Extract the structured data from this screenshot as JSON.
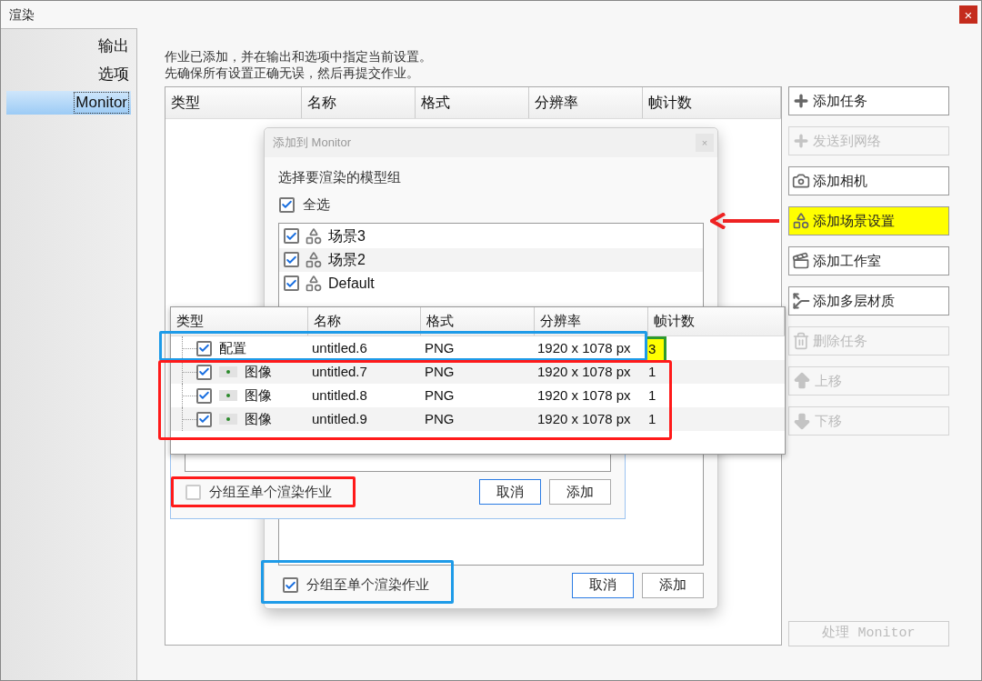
{
  "window": {
    "title": "渲染",
    "close": "×"
  },
  "sidebar": {
    "items": [
      {
        "label": "输出",
        "selected": false
      },
      {
        "label": "选项",
        "selected": false
      },
      {
        "label": "Monitor",
        "selected": true
      }
    ]
  },
  "description": [
    "作业已添加，并在输出和选项中指定当前设置。",
    "先确保所有设置正确无误，然后再提交作业。"
  ],
  "table": {
    "columns": [
      "类型",
      "名称",
      "格式",
      "分辨率",
      "帧计数"
    ]
  },
  "actions": [
    {
      "label": "添加任务",
      "kind": "add",
      "disabled": false,
      "highlighted": false
    },
    {
      "label": "发送到网络",
      "kind": "add",
      "disabled": true,
      "highlighted": false
    },
    {
      "label": "添加相机",
      "kind": "camera",
      "disabled": false,
      "highlighted": false
    },
    {
      "label": "添加场景设置",
      "kind": "scene",
      "disabled": false,
      "highlighted": true
    },
    {
      "label": "添加工作室",
      "kind": "studio",
      "disabled": false,
      "highlighted": false
    },
    {
      "label": "添加多层材质",
      "kind": "material",
      "disabled": false,
      "highlighted": false
    },
    {
      "label": "删除任务",
      "kind": "delete",
      "disabled": true,
      "highlighted": false
    },
    {
      "label": "上移",
      "kind": "up",
      "disabled": true,
      "highlighted": false
    },
    {
      "label": "下移",
      "kind": "down",
      "disabled": true,
      "highlighted": false
    }
  ],
  "process_button": {
    "label": "处理 Monitor",
    "disabled": true
  },
  "add_dialog": {
    "title": "添加到 Monitor",
    "close": "×",
    "prompt": "选择要渲染的模型组",
    "select_all": {
      "label": "全选",
      "checked": true
    },
    "groups": [
      {
        "label": "场景3",
        "checked": true
      },
      {
        "label": "场景2",
        "checked": true
      },
      {
        "label": "Default",
        "checked": true
      }
    ],
    "group_option": {
      "label": "分组至单个渲染作业",
      "checked": true
    },
    "buttons": [
      "取消",
      "添加"
    ]
  },
  "second_dialog": {
    "group_option": {
      "label": "分组至单个渲染作业",
      "checked": false
    },
    "buttons": [
      "取消",
      "添加"
    ]
  },
  "job_table": {
    "columns": [
      "类型",
      "名称",
      "格式",
      "分辨率",
      "帧计数"
    ],
    "rows": [
      {
        "kind": "config",
        "checked": true,
        "type": "配置",
        "name": "untitled.6",
        "format": "PNG",
        "resolution": "1920 x 1078 px",
        "frames": "3",
        "highlighted": true
      },
      {
        "kind": "image",
        "checked": true,
        "type": "图像",
        "name": "untitled.7",
        "format": "PNG",
        "resolution": "1920 x 1078 px",
        "frames": "1",
        "highlighted": false
      },
      {
        "kind": "image",
        "checked": true,
        "type": "图像",
        "name": "untitled.8",
        "format": "PNG",
        "resolution": "1920 x 1078 px",
        "frames": "1",
        "highlighted": false
      },
      {
        "kind": "image",
        "checked": true,
        "type": "图像",
        "name": "untitled.9",
        "format": "PNG",
        "resolution": "1920 x 1078 px",
        "frames": "1",
        "highlighted": false
      }
    ]
  }
}
